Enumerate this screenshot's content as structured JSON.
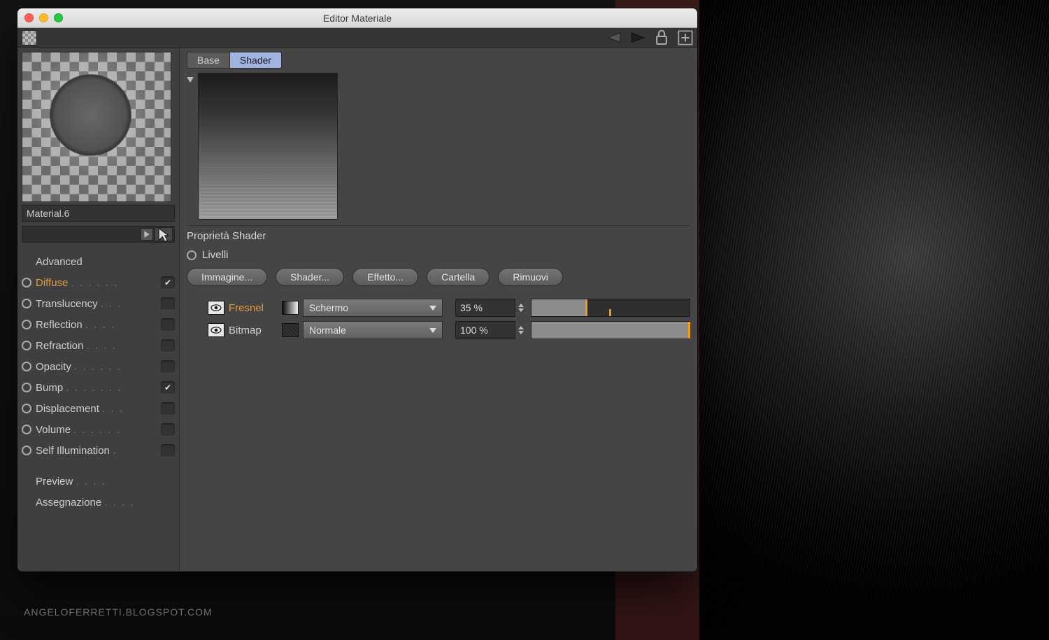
{
  "window": {
    "title": "Editor Materiale"
  },
  "sidebar": {
    "material_name": "Material.6",
    "advanced_label": "Advanced",
    "channels": [
      {
        "label": "Diffuse",
        "checked": true,
        "active": true,
        "has_radio": true
      },
      {
        "label": "Translucency",
        "checked": false,
        "has_radio": true
      },
      {
        "label": "Reflection",
        "checked": false,
        "has_radio": true
      },
      {
        "label": "Refraction",
        "checked": false,
        "has_radio": true
      },
      {
        "label": "Opacity",
        "checked": false,
        "has_radio": true
      },
      {
        "label": "Bump",
        "checked": true,
        "has_radio": true
      },
      {
        "label": "Displacement",
        "checked": false,
        "has_radio": true
      },
      {
        "label": "Volume",
        "checked": false,
        "has_radio": true
      },
      {
        "label": "Self Illumination",
        "checked": false,
        "has_radio": true
      }
    ],
    "extra": [
      {
        "label": "Preview"
      },
      {
        "label": "Assegnazione"
      }
    ]
  },
  "main": {
    "tabs": {
      "base": "Base",
      "shader": "Shader"
    },
    "section_title": "Proprietà Shader",
    "levels_label": "Livelli",
    "buttons": {
      "image": "Immagine...",
      "shader": "Shader...",
      "effect": "Effetto...",
      "folder": "Cartella",
      "remove": "Rimuovi"
    },
    "layers": [
      {
        "name": "Fresnel",
        "orange": true,
        "swatch": "grad",
        "mode": "Schermo",
        "percent": "35 %",
        "fill": 35
      },
      {
        "name": "Bitmap",
        "orange": false,
        "swatch": "tex",
        "mode": "Normale",
        "percent": "100 %",
        "fill": 100
      }
    ]
  },
  "watermark": "ANGELOFERRETTI.BLOGSPOT.COM"
}
